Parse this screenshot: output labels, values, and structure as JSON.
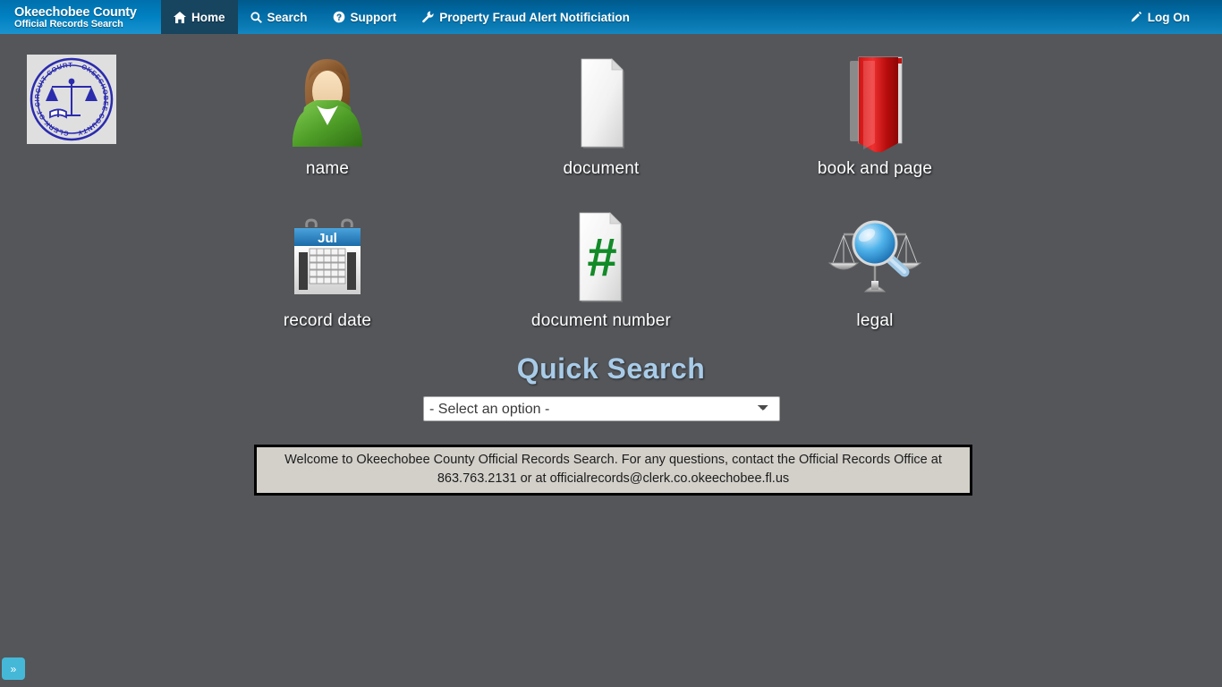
{
  "navbar": {
    "brand_title": "Okeechobee County",
    "brand_subtitle": "Official Records Search",
    "items": [
      {
        "label": "Home",
        "icon": "home-icon",
        "active": true
      },
      {
        "label": "Search",
        "icon": "magnifier-icon",
        "active": false
      },
      {
        "label": "Support",
        "icon": "question-circle-icon",
        "active": false
      },
      {
        "label": "Property Fraud Alert Notificiation",
        "icon": "wrench-icon",
        "active": false
      }
    ],
    "logon_label": "Log On",
    "logon_icon": "pencil-icon"
  },
  "seal": {
    "top_text": "CLERK OF CIRCUIT COURT",
    "bottom_text": "OKEECHOBEE COUNTY"
  },
  "search_tiles": [
    {
      "label": "name",
      "icon": "person-icon"
    },
    {
      "label": "document",
      "icon": "document-icon"
    },
    {
      "label": "book and page",
      "icon": "red-book-icon"
    },
    {
      "label": "record date",
      "icon": "calendar-icon",
      "calendar_month": "Jul"
    },
    {
      "label": "document number",
      "icon": "document-hash-icon",
      "symbol": "#"
    },
    {
      "label": "legal",
      "icon": "scales-magnifier-icon"
    }
  ],
  "quick_search": {
    "title": "Quick Search",
    "select_value": "- Select an option -",
    "options": [
      "- Select an option -"
    ]
  },
  "welcome": {
    "text": "Welcome to Okeechobee County Official Records Search. For any questions, contact the Official Records Office at 863.763.2131 or at officialrecords@clerk.co.okeechobee.fl.us"
  },
  "side_toggle": {
    "label": "»"
  },
  "colors": {
    "page_bg": "#54565a",
    "navbar_blue": "#0069a3",
    "brand_blue": "#0081c2",
    "active_tab": "#17445f",
    "quick_search_text": "#a8cbe8",
    "welcome_bg": "#d3d0ca",
    "toggle_blue": "#45b8d8"
  }
}
